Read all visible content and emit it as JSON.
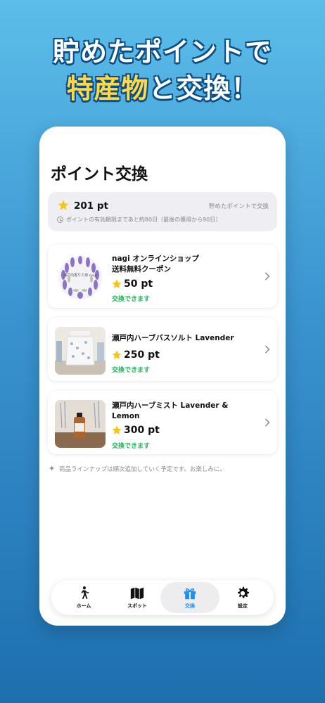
{
  "promo": {
    "line1": "貯めたポイントで",
    "line2_highlight": "特産物",
    "line2_rest": "と交換！"
  },
  "page": {
    "title": "ポイント交換"
  },
  "points": {
    "value": "201 pt",
    "hint": "貯めたポイントで交換",
    "expiry": "ポイントの有効期限まであと約80日（最後の獲得から90日）"
  },
  "items": [
    {
      "name_line1": "nagi オンラインショップ",
      "name_line2": "送料無料クーポン",
      "price": "50 pt",
      "status": "交換できます",
      "thumb_text": "瀬戸内香り工房 nagi"
    },
    {
      "name_line1": "瀬戸内ハーブバスソルト Lavender",
      "name_line2": "",
      "price": "250 pt",
      "status": "交換できます"
    },
    {
      "name_line1": "瀬戸内ハーブミスト Lavender &",
      "name_line2": "Lemon",
      "price": "300 pt",
      "status": "交換できます"
    }
  ],
  "footnote": "商品ラインナップは順次追加していく予定です。お楽しみに。",
  "tabs": [
    {
      "label": "ホーム",
      "icon": "walking-person-icon"
    },
    {
      "label": "スポット",
      "icon": "map-icon"
    },
    {
      "label": "交換",
      "icon": "gift-icon",
      "active": true
    },
    {
      "label": "設定",
      "icon": "gear-icon"
    }
  ],
  "colors": {
    "accent": "#1e8ef0",
    "star": "#f5c518",
    "available": "#1db954",
    "highlight": "#ffd84a"
  }
}
